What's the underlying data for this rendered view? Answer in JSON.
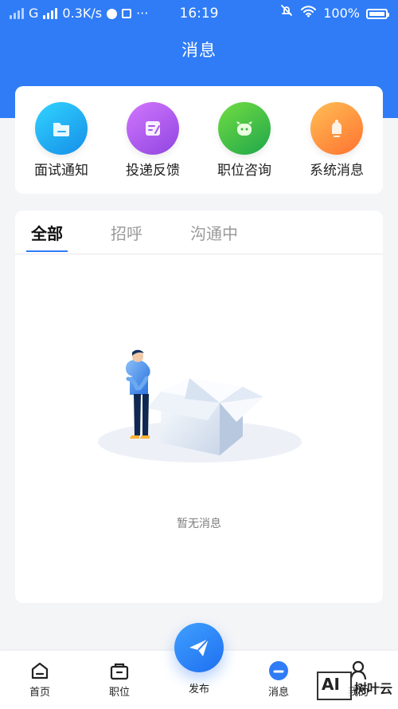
{
  "status_bar": {
    "carrier": "G",
    "speed": "0.3K/s",
    "dots": "···",
    "time": "16:19",
    "battery": "100%"
  },
  "header": {
    "title": "消息"
  },
  "quick_actions": [
    {
      "label": "面试通知",
      "icon": "folder-icon",
      "color": "#21b7ef"
    },
    {
      "label": "投递反馈",
      "icon": "feedback-icon",
      "color": "#b56cf4"
    },
    {
      "label": "职位咨询",
      "icon": "robot-icon",
      "color": "#42c45b"
    },
    {
      "label": "系统消息",
      "icon": "bell-icon",
      "color": "#ff8d3a"
    }
  ],
  "tabs": [
    {
      "label": "全部",
      "active": true
    },
    {
      "label": "招呼",
      "active": false
    },
    {
      "label": "沟通中",
      "active": false
    }
  ],
  "empty_state": {
    "message": "暂无消息",
    "icon": "empty-box-person-illustration"
  },
  "bottom_nav": {
    "home": "首页",
    "jobs": "职位",
    "publish": "发布",
    "messages": "消息",
    "profile": "我的"
  },
  "watermark": {
    "logo": "AI",
    "name": "树叶云"
  },
  "colors": {
    "primary": "#2f7cf6",
    "background": "#f4f5f7",
    "card": "#ffffff"
  }
}
